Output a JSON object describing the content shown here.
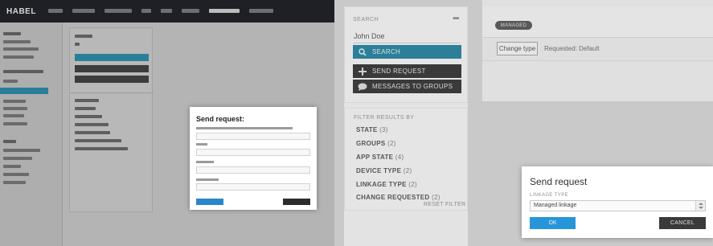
{
  "thumbnail": {
    "logo": "HABEL",
    "modal_title": "Send request:"
  },
  "search": {
    "label": "SEARCH",
    "menu_glyph": "•••",
    "value": "John Doe",
    "search_button": "SEARCH",
    "send_request_button": "SEND REQUEST",
    "messages_button": "MESSAGES TO GROUPS"
  },
  "filter": {
    "title": "FILTER RESULTS BY",
    "items": [
      {
        "label": "STATE",
        "count": "(3)"
      },
      {
        "label": "GROUPS",
        "count": "(2)"
      },
      {
        "label": "APP STATE",
        "count": "(4)"
      },
      {
        "label": "DEVICE TYPE",
        "count": "(2)"
      },
      {
        "label": "LINKAGE TYPE",
        "count": "(2)"
      },
      {
        "label": "CHANGE REQUESTED",
        "count": "(2)"
      }
    ],
    "reset": "RESET FILTER"
  },
  "detail": {
    "pill": "MANAGED",
    "change_type_button": "Change type",
    "requested_text": "Requested: Default"
  },
  "dialog": {
    "title": "Send request",
    "field_label": "LINKAGE TYPE",
    "selected_value": "Managed linkage",
    "ok": "OK",
    "cancel": "CANCEL"
  },
  "colors": {
    "accent_teal": "#2d7f99",
    "ok_blue": "#2796d8",
    "dark_button": "#3a3a3a"
  }
}
